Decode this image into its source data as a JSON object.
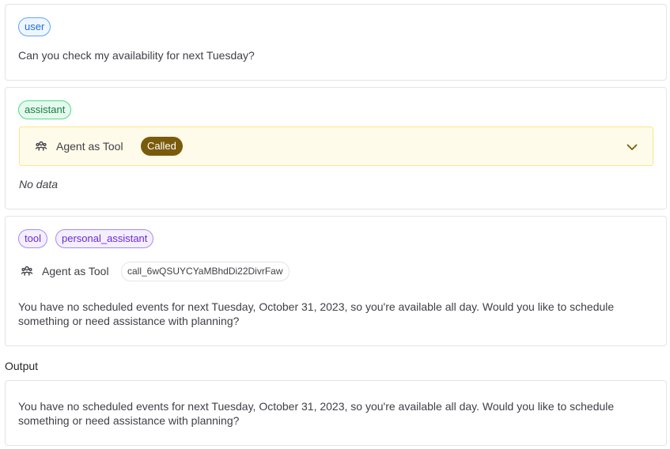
{
  "messages": {
    "user": {
      "role": "user",
      "text": "Can you check my availability for next Tuesday?"
    },
    "assistant": {
      "role": "assistant",
      "tool_call": {
        "name": "Agent as Tool",
        "status": "Called",
        "icon": "agent-icon"
      },
      "empty_text": "No data"
    },
    "tool": {
      "role": "tool",
      "tool_name": "personal_assistant",
      "agent_label": "Agent as Tool",
      "call_id": "call_6wQSUYCYaMBhdDi22DivrFaw",
      "text": "You have no scheduled events for next Tuesday, October 31, 2023, so you're available all day. Would you like to schedule something or need assistance with planning?"
    }
  },
  "output": {
    "label": "Output",
    "text": "You have no scheduled events for next Tuesday, October 31, 2023, so you're available all day. Would you like to schedule something or need assistance with planning?"
  },
  "colors": {
    "user_pill": "#1d6fd8",
    "assistant_pill": "#15803d",
    "tool_pill": "#6d28d9",
    "called_badge": "#7a5b0b",
    "tool_call_bg": "#fefbea"
  }
}
